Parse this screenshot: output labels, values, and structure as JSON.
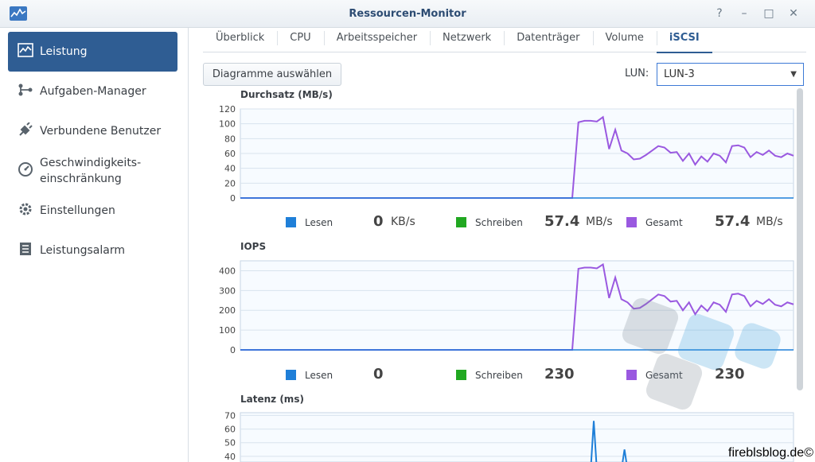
{
  "window": {
    "title": "Ressourcen-Monitor",
    "controls": [
      "?",
      "–",
      "□",
      "✕"
    ]
  },
  "sidebar": {
    "items": [
      {
        "label": "Leistung",
        "icon": "performance-chart-icon",
        "active": true
      },
      {
        "label": "Aufgaben-Manager",
        "icon": "task-manager-icon",
        "active": false
      },
      {
        "label": "Verbundene Benutzer",
        "icon": "plug-icon",
        "active": false
      },
      {
        "label": "Geschwindigkeits-",
        "label2": "einschränkung",
        "icon": "gauge-icon",
        "active": false
      },
      {
        "label": "Einstellungen",
        "icon": "gear-icon",
        "active": false
      },
      {
        "label": "Leistungsalarm",
        "icon": "list-icon",
        "active": false
      }
    ]
  },
  "tabs": [
    {
      "label": "Überblick",
      "active": false
    },
    {
      "label": "CPU",
      "active": false
    },
    {
      "label": "Arbeitsspeicher",
      "active": false
    },
    {
      "label": "Netzwerk",
      "active": false
    },
    {
      "label": "Datenträger",
      "active": false
    },
    {
      "label": "Volume",
      "active": false
    },
    {
      "label": "iSCSI",
      "active": true
    }
  ],
  "toolbar": {
    "choose_charts": "Diagramme auswählen",
    "lun_label": "LUN:",
    "lun_value": "LUN-3"
  },
  "charts": {
    "throughput": {
      "title": "Durchsatz (MB/s)",
      "stats": {
        "read_label": "Lesen",
        "read_value": "0",
        "read_unit": "KB/s",
        "write_label": "Schreiben",
        "write_value": "57.4",
        "write_unit": "MB/s",
        "total_label": "Gesamt",
        "total_value": "57.4",
        "total_unit": "MB/s"
      }
    },
    "iops": {
      "title": "IOPS",
      "stats": {
        "read_label": "Lesen",
        "read_value": "0",
        "write_label": "Schreiben",
        "write_value": "230",
        "total_label": "Gesamt",
        "total_value": "230"
      }
    },
    "latency": {
      "title": "Latenz (ms)"
    }
  },
  "colors": {
    "read": "#1f7fd8",
    "write": "#21a821",
    "total": "#9a59e0",
    "accent": "#2f5d93"
  },
  "footer": {
    "watermark": "fireblsblog.de©"
  },
  "chart_data": [
    {
      "type": "line",
      "title": "Durchsatz (MB/s)",
      "ylim": [
        0,
        120
      ],
      "yticks": [
        0,
        20,
        40,
        60,
        80,
        100,
        120
      ],
      "x": [
        0,
        54,
        55,
        56,
        57,
        58,
        59,
        60,
        61,
        62,
        63,
        64,
        65,
        66,
        67,
        68,
        69,
        70,
        71,
        72,
        73,
        74,
        75,
        76,
        77,
        78,
        79,
        80,
        81,
        82,
        83,
        84,
        85,
        86,
        87,
        88,
        89,
        90
      ],
      "series": [
        {
          "name": "Gesamt",
          "values": [
            0,
            0,
            102,
            104,
            104,
            103,
            109,
            66,
            92,
            64,
            60,
            52,
            53,
            58,
            64,
            70,
            68,
            61,
            62,
            50,
            60,
            45,
            56,
            49,
            60,
            57,
            48,
            70,
            71,
            68,
            55,
            62,
            58,
            64,
            57,
            55,
            60,
            57
          ]
        },
        {
          "name": "Lesen",
          "values": [
            0,
            0
          ]
        }
      ]
    },
    {
      "type": "line",
      "title": "IOPS",
      "ylim": [
        0,
        450
      ],
      "yticks": [
        0,
        100,
        200,
        300,
        400
      ],
      "x": [
        0,
        54,
        55,
        56,
        57,
        58,
        59,
        60,
        61,
        62,
        63,
        64,
        65,
        66,
        67,
        68,
        69,
        70,
        71,
        72,
        73,
        74,
        75,
        76,
        77,
        78,
        79,
        80,
        81,
        82,
        83,
        84,
        85,
        86,
        87,
        88,
        89,
        90
      ],
      "series": [
        {
          "name": "Gesamt",
          "values": [
            0,
            0,
            410,
            416,
            416,
            412,
            432,
            262,
            366,
            256,
            240,
            208,
            212,
            232,
            256,
            280,
            272,
            244,
            248,
            200,
            240,
            180,
            224,
            196,
            240,
            228,
            192,
            280,
            284,
            272,
            220,
            248,
            232,
            256,
            228,
            220,
            240,
            230
          ]
        },
        {
          "name": "Lesen",
          "values": [
            0,
            0
          ]
        }
      ]
    },
    {
      "type": "line",
      "title": "Latenz (ms)",
      "ylim": [
        30,
        72
      ],
      "yticks": [
        40,
        50,
        60,
        70
      ],
      "x": [
        0,
        57,
        57.5,
        58,
        62,
        62.5,
        63
      ],
      "series": [
        {
          "name": "Gesamt",
          "values": [
            30,
            30,
            66,
            30,
            30,
            45,
            30
          ]
        }
      ]
    }
  ]
}
